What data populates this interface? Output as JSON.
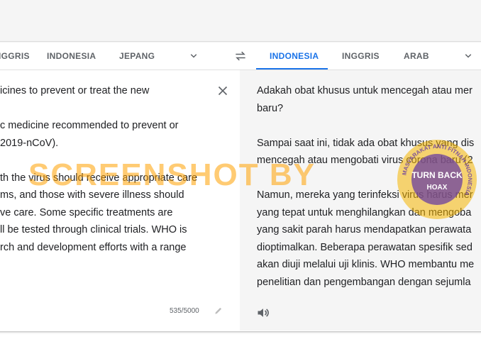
{
  "source_tabs": [
    {
      "label": "INGGRIS",
      "display": "IGGRIS"
    },
    {
      "label": "INDONESIA"
    },
    {
      "label": "JEPANG"
    }
  ],
  "target_tabs": [
    {
      "label": "INDONESIA",
      "active": true
    },
    {
      "label": "INGGRIS"
    },
    {
      "label": "ARAB"
    }
  ],
  "source_text": "icines to prevent or treat the new\n\nc medicine recommended to prevent or\n2019-nCoV).\n\nth the virus should receive appropriate care\nms, and those with severe illness should\nve care. Some specific treatments are\nll be tested through clinical trials. WHO is\nrch and development efforts with a range",
  "target_text": "Adakah obat khusus untuk mencegah atau mer\nbaru?\n\nSampai saat ini, tidak ada obat khusus yang dis\nmencegah atau mengobati virus corona baru (2\n\nNamun, mereka yang terinfeksi virus harus mer\nyang tepat untuk menghilangkan dan mengoba\nyang sakit parah harus mendapatkan perawata\ndioptimalkan. Beberapa perawatan spesifik sed\nakan diuji melalui uji klinis. WHO membantu me\npenelitian dan pengembangan dengan sejumla",
  "char_counter": "535/5000",
  "watermark": {
    "text": "SCREENSHOT BY",
    "badge_center": "TURN BACK",
    "badge_ring": "MASYARAKAT ANTI FITNAH INDONESIA",
    "badge_bottom": "HOAX"
  },
  "colors": {
    "accent": "#1a73e8",
    "watermark": "#ffa000",
    "badge_purple": "#6a3fa0",
    "badge_gold": "#f4b400"
  },
  "icons": [
    "swap-languages-icon",
    "chevron-down-icon",
    "close-icon",
    "pencil-icon",
    "speaker-icon"
  ]
}
